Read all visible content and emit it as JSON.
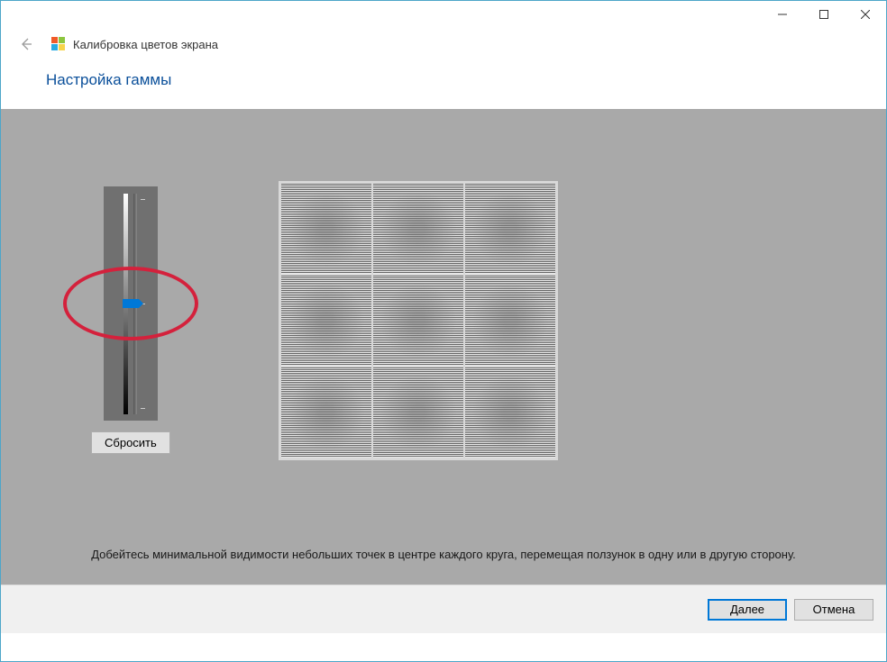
{
  "window": {
    "wizard_title": "Калибровка цветов экрана"
  },
  "page": {
    "heading": "Настройка гаммы",
    "instruction": "Добейтесь минимальной видимости небольших точек в центре каждого круга, перемещая ползунок в одну или в другую сторону."
  },
  "buttons": {
    "reset": "Сбросить",
    "next": "Далее",
    "cancel": "Отмена"
  }
}
